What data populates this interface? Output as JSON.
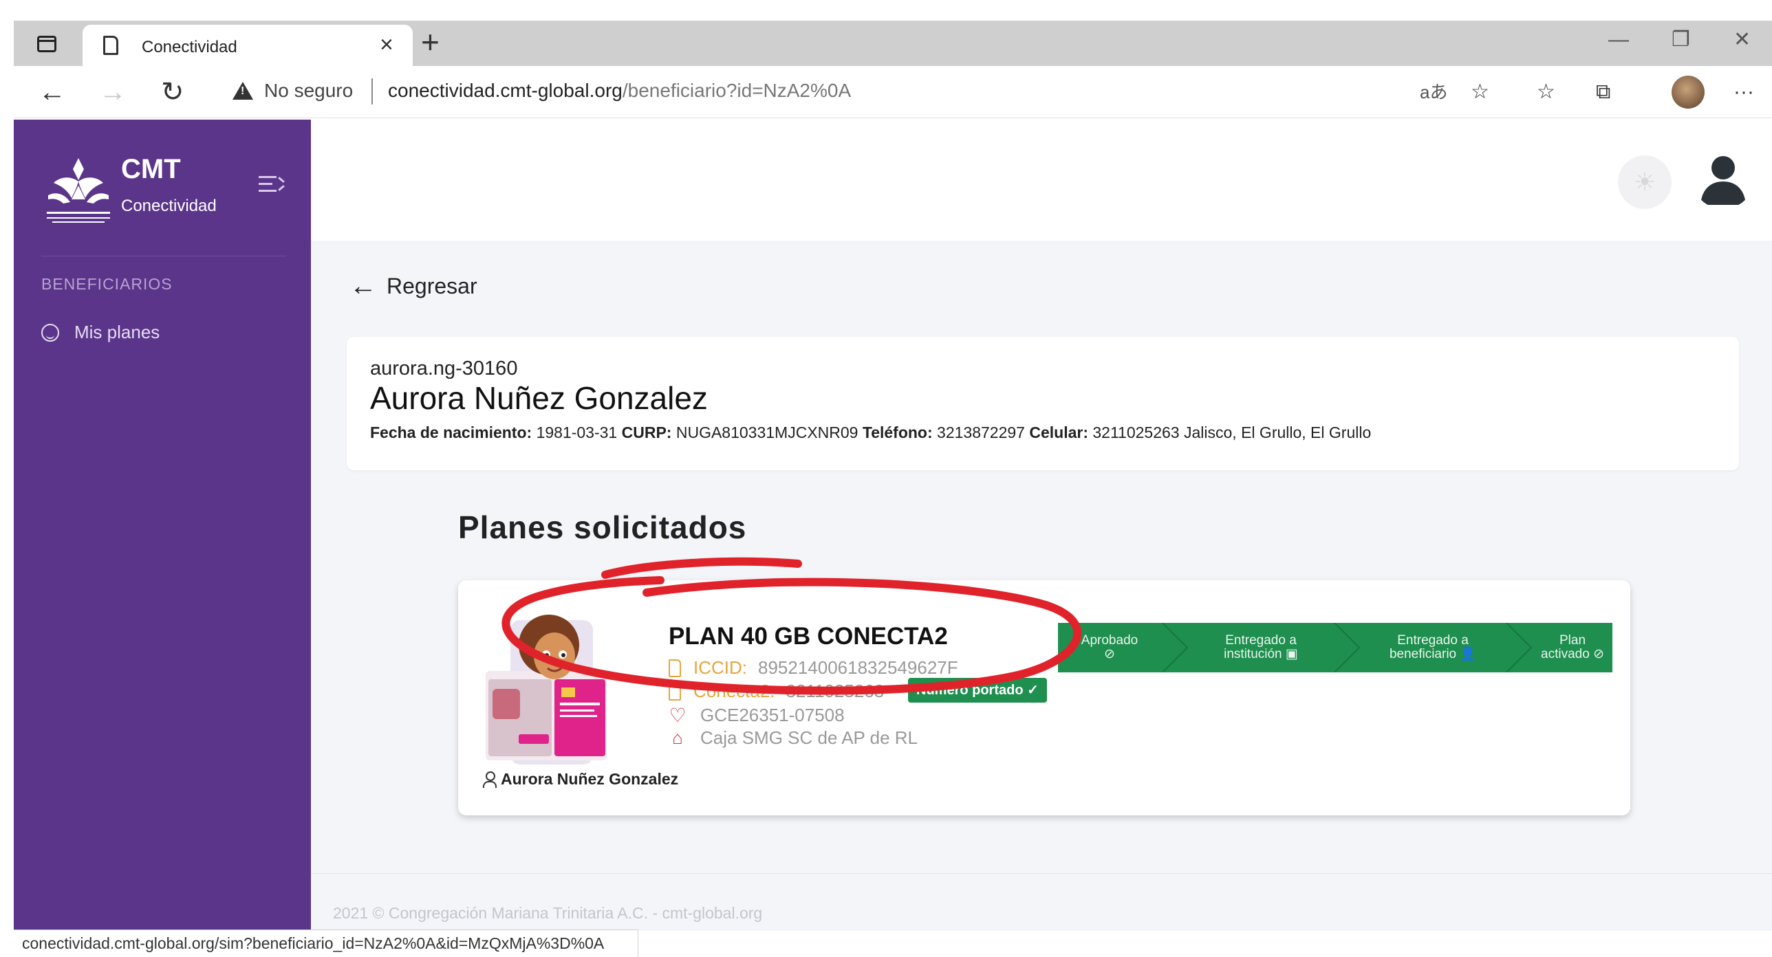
{
  "browser": {
    "tab_title": "Conectividad",
    "security_label": "No seguro",
    "url_host": "conectividad.cmt-global.org",
    "url_path": "/beneficiario?id=NzA2%0A",
    "read_aloud_label": "aあ",
    "status_url": "conectividad.cmt-global.org/sim?beneficiario_id=NzA2%0A&id=MzQxMjA%3D%0A"
  },
  "sidebar": {
    "brand_name": "CMT",
    "brand_sub": "Conectividad",
    "section_heading": "BENEFICIARIOS",
    "items": [
      {
        "label": "Mis planes",
        "icon": "smiley-icon"
      }
    ]
  },
  "page": {
    "back_label": "Regresar",
    "beneficiary": {
      "username": "aurora.ng-30160",
      "full_name": "Aurora Nuñez Gonzalez",
      "birth_label": "Fecha de nacimiento:",
      "birth_value": "1981-03-31",
      "curp_label": "CURP:",
      "curp_value": "NUGA810331MJCXNR09",
      "phone_label": "Teléfono:",
      "phone_value": "3213872297",
      "cell_label": "Celular:",
      "cell_value": "3211025263",
      "location": "Jalisco, El Grullo, El Grullo"
    },
    "section_title": "Planes solicitados",
    "plan": {
      "name": "PLAN 40 GB CONECTA2",
      "iccid_label": "ICCID:",
      "iccid_value": "8952140061832549627F",
      "number_label": "Conecta2:",
      "number_value": "3211025263",
      "ported_badge": "Número portado ✓",
      "folio": "GCE26351-07508",
      "institution": "Caja SMG SC de AP de RL",
      "owner": "Aurora Nuñez Gonzalez",
      "progress_fraction": 1.0,
      "steps": [
        {
          "line1": "Aprobado",
          "line2": ""
        },
        {
          "line1": "Entregado a",
          "line2": "institución"
        },
        {
          "line1": "Entregado a",
          "line2": "beneficiario"
        },
        {
          "line1": "Plan",
          "line2": "activado"
        }
      ]
    },
    "footer": "2021 © Congregación Mariana Trinitaria A.C. - cmt-global.org"
  },
  "colors": {
    "sidebar_bg": "#5b3589",
    "progress_green": "#1e8f4e",
    "annotation_red": "#e0232b",
    "iccid_orange": "#e8a43b"
  }
}
